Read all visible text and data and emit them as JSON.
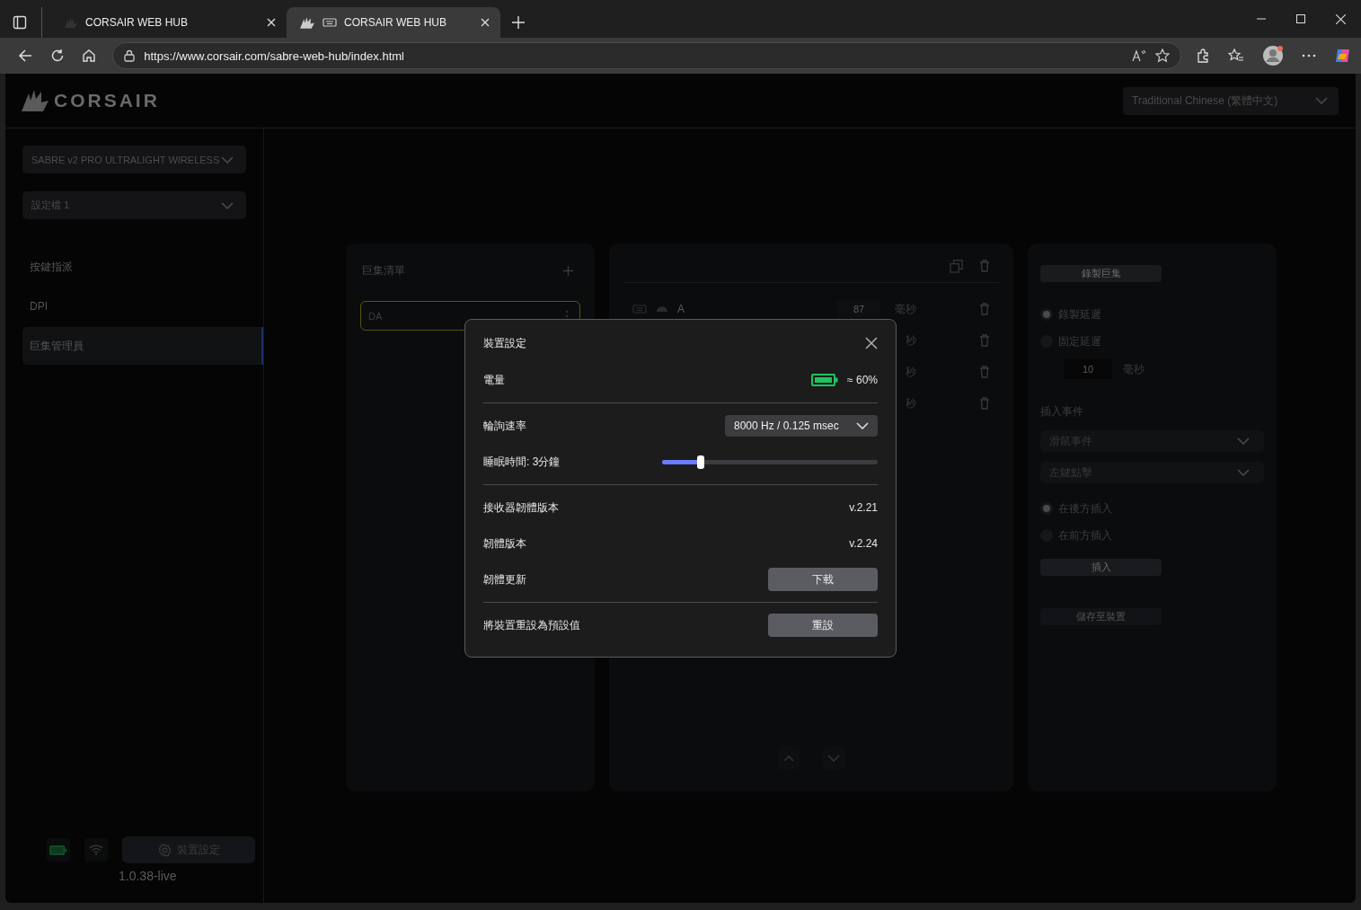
{
  "browser": {
    "tabs": [
      {
        "title": "CORSAIR WEB HUB",
        "selected": false
      },
      {
        "title": "CORSAIR WEB HUB",
        "selected": true
      }
    ],
    "url": "https://www.corsair.com/sabre-web-hub/index.html"
  },
  "header": {
    "logo": "CORSAIR",
    "language": "Traditional Chinese (繁體中文)"
  },
  "sidebar": {
    "device": "SABRE v2 PRO ULTRALIGHT WIRELESS",
    "profile": "設定檔 1",
    "nav": [
      {
        "label": "按鍵指派",
        "selected": false
      },
      {
        "label": "DPI",
        "selected": false
      },
      {
        "label": "巨集管理員",
        "selected": true
      }
    ],
    "settings_button": "裝置設定",
    "version": "1.0.38-live"
  },
  "macro_list": {
    "title": "巨集清單",
    "items": [
      {
        "name": "DA",
        "selected": true
      }
    ]
  },
  "macro_editor": {
    "rows": [
      {
        "key": "A",
        "delay": "87",
        "unit": "毫秒"
      },
      {
        "unit": "秒"
      },
      {
        "unit": "秒"
      },
      {
        "unit": "秒"
      }
    ]
  },
  "recorder": {
    "record_button": "錄製巨集",
    "delay_modes": [
      {
        "label": "錄製延遲",
        "selected": true
      },
      {
        "label": "固定延遲",
        "selected": false
      }
    ],
    "fixed_delay": "10",
    "fixed_delay_unit": "毫秒",
    "insert_title": "插入事件",
    "event_type": "滑鼠事件",
    "event": "左鍵點擊",
    "positions": [
      {
        "label": "在後方插入",
        "selected": true
      },
      {
        "label": "在前方插入",
        "selected": false
      }
    ],
    "insert_button": "插入",
    "save_button": "儲存至裝置"
  },
  "dialog": {
    "title": "裝置設定",
    "battery_label": "電量",
    "battery_reading": "≈ 60%",
    "polling_label": "輪詢速率",
    "polling_value": "8000 Hz / 0.125 msec",
    "sleep_label": "睡眠時間: 3分鐘",
    "sleep": {
      "level": 0.18
    },
    "receiver_fw_label": "接收器韌體版本",
    "receiver_fw": "v.2.21",
    "fw_label": "韌體版本",
    "fw": "v.2.24",
    "update_label": "韌體更新",
    "update_button": "下載",
    "reset_label": "將裝置重設為預設值",
    "reset_button": "重設"
  }
}
